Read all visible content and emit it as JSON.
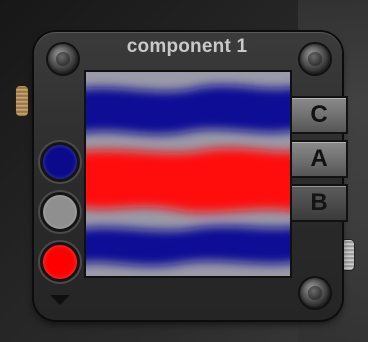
{
  "panel": {
    "title": "component 1"
  },
  "layers": [
    {
      "label": "C",
      "state": "highlighted"
    },
    {
      "label": "A",
      "state": "highlighted"
    },
    {
      "label": "B",
      "state": "normal"
    }
  ],
  "swatches": [
    {
      "name": "blue",
      "color": "#0a0a8a"
    },
    {
      "name": "gray",
      "color": "#8f8f8f"
    },
    {
      "name": "red",
      "color": "#ff0000"
    }
  ],
  "colors": {
    "band_blue": "#0b0b95",
    "band_red": "#ff0a0a",
    "band_gray": "#9a9aa8"
  },
  "icons": {
    "collapse": "triangle-down-icon",
    "screw": "screw-icon",
    "knob": "knob-icon"
  }
}
